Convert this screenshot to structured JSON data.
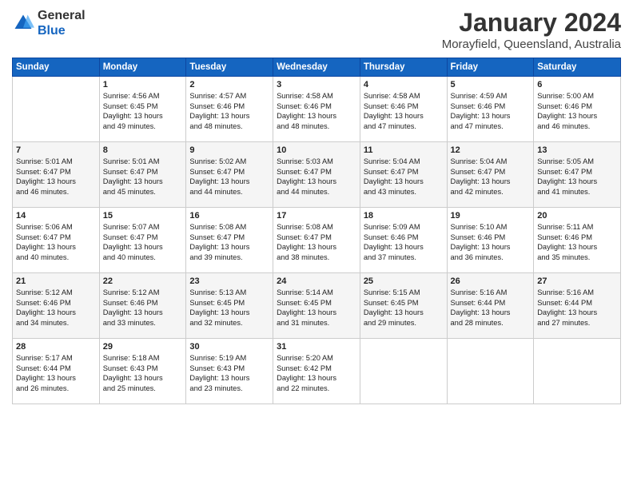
{
  "header": {
    "logo_line1": "General",
    "logo_line2": "Blue",
    "month": "January 2024",
    "location": "Morayfield, Queensland, Australia"
  },
  "days_of_week": [
    "Sunday",
    "Monday",
    "Tuesday",
    "Wednesday",
    "Thursday",
    "Friday",
    "Saturday"
  ],
  "weeks": [
    [
      {
        "day": "",
        "content": ""
      },
      {
        "day": "1",
        "content": "Sunrise: 4:56 AM\nSunset: 6:45 PM\nDaylight: 13 hours\nand 49 minutes."
      },
      {
        "day": "2",
        "content": "Sunrise: 4:57 AM\nSunset: 6:46 PM\nDaylight: 13 hours\nand 48 minutes."
      },
      {
        "day": "3",
        "content": "Sunrise: 4:58 AM\nSunset: 6:46 PM\nDaylight: 13 hours\nand 48 minutes."
      },
      {
        "day": "4",
        "content": "Sunrise: 4:58 AM\nSunset: 6:46 PM\nDaylight: 13 hours\nand 47 minutes."
      },
      {
        "day": "5",
        "content": "Sunrise: 4:59 AM\nSunset: 6:46 PM\nDaylight: 13 hours\nand 47 minutes."
      },
      {
        "day": "6",
        "content": "Sunrise: 5:00 AM\nSunset: 6:46 PM\nDaylight: 13 hours\nand 46 minutes."
      }
    ],
    [
      {
        "day": "7",
        "content": "Sunrise: 5:01 AM\nSunset: 6:47 PM\nDaylight: 13 hours\nand 46 minutes."
      },
      {
        "day": "8",
        "content": "Sunrise: 5:01 AM\nSunset: 6:47 PM\nDaylight: 13 hours\nand 45 minutes."
      },
      {
        "day": "9",
        "content": "Sunrise: 5:02 AM\nSunset: 6:47 PM\nDaylight: 13 hours\nand 44 minutes."
      },
      {
        "day": "10",
        "content": "Sunrise: 5:03 AM\nSunset: 6:47 PM\nDaylight: 13 hours\nand 44 minutes."
      },
      {
        "day": "11",
        "content": "Sunrise: 5:04 AM\nSunset: 6:47 PM\nDaylight: 13 hours\nand 43 minutes."
      },
      {
        "day": "12",
        "content": "Sunrise: 5:04 AM\nSunset: 6:47 PM\nDaylight: 13 hours\nand 42 minutes."
      },
      {
        "day": "13",
        "content": "Sunrise: 5:05 AM\nSunset: 6:47 PM\nDaylight: 13 hours\nand 41 minutes."
      }
    ],
    [
      {
        "day": "14",
        "content": "Sunrise: 5:06 AM\nSunset: 6:47 PM\nDaylight: 13 hours\nand 40 minutes."
      },
      {
        "day": "15",
        "content": "Sunrise: 5:07 AM\nSunset: 6:47 PM\nDaylight: 13 hours\nand 40 minutes."
      },
      {
        "day": "16",
        "content": "Sunrise: 5:08 AM\nSunset: 6:47 PM\nDaylight: 13 hours\nand 39 minutes."
      },
      {
        "day": "17",
        "content": "Sunrise: 5:08 AM\nSunset: 6:47 PM\nDaylight: 13 hours\nand 38 minutes."
      },
      {
        "day": "18",
        "content": "Sunrise: 5:09 AM\nSunset: 6:46 PM\nDaylight: 13 hours\nand 37 minutes."
      },
      {
        "day": "19",
        "content": "Sunrise: 5:10 AM\nSunset: 6:46 PM\nDaylight: 13 hours\nand 36 minutes."
      },
      {
        "day": "20",
        "content": "Sunrise: 5:11 AM\nSunset: 6:46 PM\nDaylight: 13 hours\nand 35 minutes."
      }
    ],
    [
      {
        "day": "21",
        "content": "Sunrise: 5:12 AM\nSunset: 6:46 PM\nDaylight: 13 hours\nand 34 minutes."
      },
      {
        "day": "22",
        "content": "Sunrise: 5:12 AM\nSunset: 6:46 PM\nDaylight: 13 hours\nand 33 minutes."
      },
      {
        "day": "23",
        "content": "Sunrise: 5:13 AM\nSunset: 6:45 PM\nDaylight: 13 hours\nand 32 minutes."
      },
      {
        "day": "24",
        "content": "Sunrise: 5:14 AM\nSunset: 6:45 PM\nDaylight: 13 hours\nand 31 minutes."
      },
      {
        "day": "25",
        "content": "Sunrise: 5:15 AM\nSunset: 6:45 PM\nDaylight: 13 hours\nand 29 minutes."
      },
      {
        "day": "26",
        "content": "Sunrise: 5:16 AM\nSunset: 6:44 PM\nDaylight: 13 hours\nand 28 minutes."
      },
      {
        "day": "27",
        "content": "Sunrise: 5:16 AM\nSunset: 6:44 PM\nDaylight: 13 hours\nand 27 minutes."
      }
    ],
    [
      {
        "day": "28",
        "content": "Sunrise: 5:17 AM\nSunset: 6:44 PM\nDaylight: 13 hours\nand 26 minutes."
      },
      {
        "day": "29",
        "content": "Sunrise: 5:18 AM\nSunset: 6:43 PM\nDaylight: 13 hours\nand 25 minutes."
      },
      {
        "day": "30",
        "content": "Sunrise: 5:19 AM\nSunset: 6:43 PM\nDaylight: 13 hours\nand 23 minutes."
      },
      {
        "day": "31",
        "content": "Sunrise: 5:20 AM\nSunset: 6:42 PM\nDaylight: 13 hours\nand 22 minutes."
      },
      {
        "day": "",
        "content": ""
      },
      {
        "day": "",
        "content": ""
      },
      {
        "day": "",
        "content": ""
      }
    ]
  ]
}
